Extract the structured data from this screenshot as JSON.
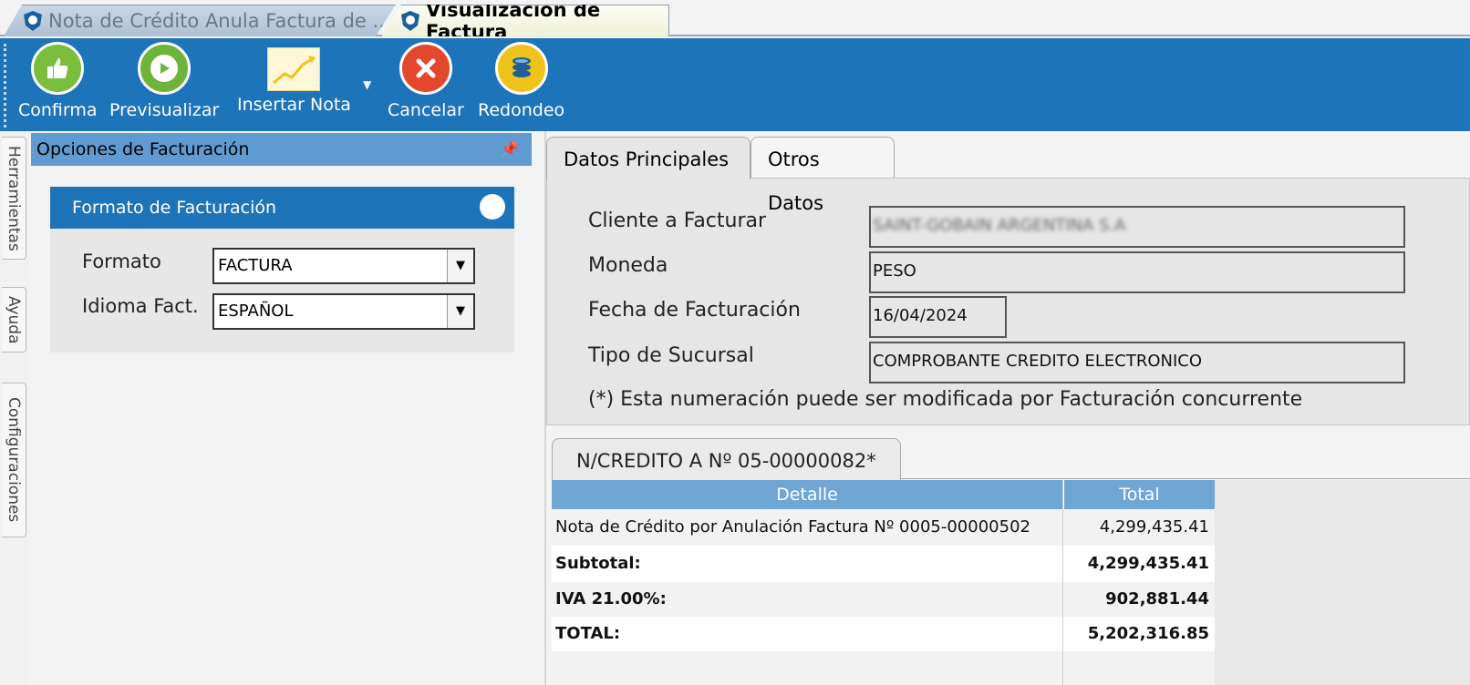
{
  "doc_tabs": [
    {
      "label": "Nota de Crédito Anula Factura de ..."
    },
    {
      "label": "Visualización de Factura"
    }
  ],
  "ribbon": {
    "confirma": "Confirma",
    "previsualizar": "Previsualizar",
    "insertar_nota": "Insertar Nota",
    "cancelar": "Cancelar",
    "redondeo": "Redondeo"
  },
  "side_tabs": [
    "Herramientas",
    "Ayuda",
    "Configuraciones"
  ],
  "options_panel": {
    "title": "Opciones de Facturación",
    "section_title": "Formato de Facturación",
    "formato_label": "Formato",
    "formato_value": "FACTURA",
    "idioma_label": "Idioma Fact.",
    "idioma_value": "ESPAÑOL"
  },
  "form_tabs": [
    "Datos Principales",
    "Otros Datos"
  ],
  "form": {
    "cliente_label": "Cliente a Facturar",
    "cliente_value": "SAINT-GOBAIN ARGENTINA S.A",
    "moneda_label": "Moneda",
    "moneda_value": "PESO",
    "fecha_label": "Fecha de Facturación",
    "fecha_value": "16/04/2024",
    "sucursal_label": "Tipo de Sucursal",
    "sucursal_value": "COMPROBANTE CREDITO ELECTRONICO",
    "note": "(*) Esta numeración puede ser modificada por Facturación concurrente"
  },
  "grid": {
    "tab_label": "N/CREDITO A Nº 05-00000082*",
    "columns": [
      "Detalle",
      "Total"
    ],
    "rows": [
      {
        "detalle": "Nota de Crédito por Anulación Factura Nº 0005-00000502",
        "total": "4,299,435.41",
        "bold": false
      },
      {
        "detalle": "Subtotal:",
        "total": "4,299,435.41",
        "bold": true
      },
      {
        "detalle": "IVA 21.00%:",
        "total": "902,881.44",
        "bold": true
      },
      {
        "detalle": "TOTAL:",
        "total": "5,202,316.85",
        "bold": true
      }
    ]
  }
}
